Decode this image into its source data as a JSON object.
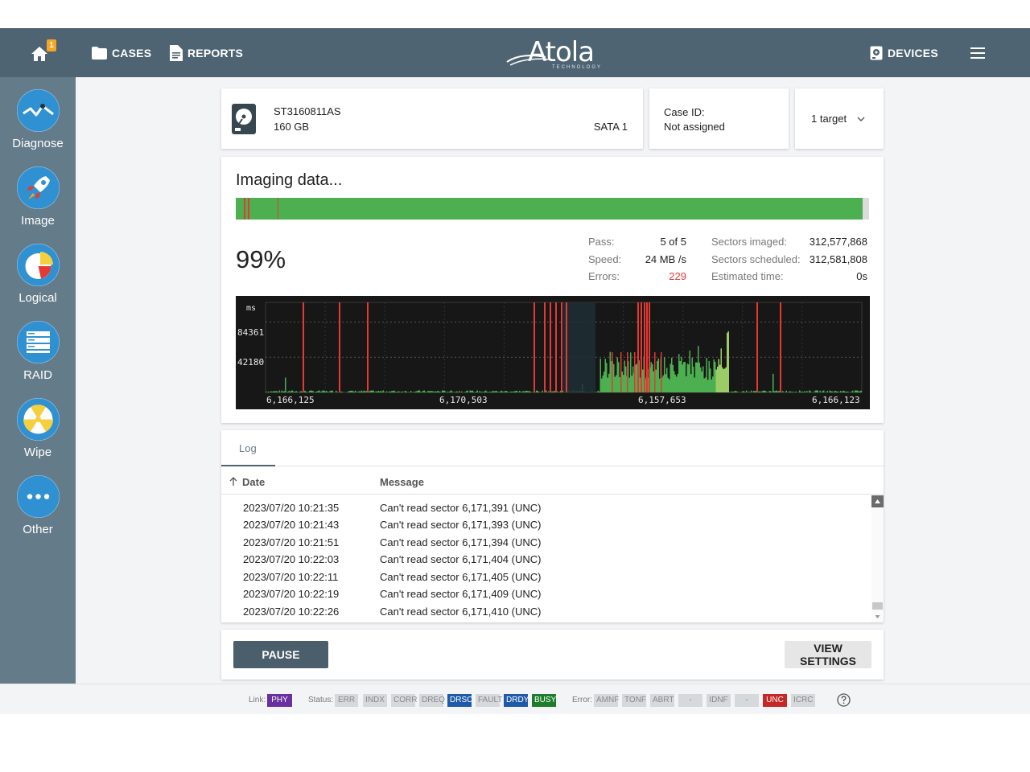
{
  "topbar": {
    "home_badge": "1",
    "cases_label": "CASES",
    "reports_label": "REPORTS",
    "logo_text": "Atola",
    "logo_subtext": "TECHNOLOGY",
    "devices_label": "DEVICES"
  },
  "sidebar": {
    "items": [
      {
        "label": "Diagnose",
        "icon": "diagnose-icon"
      },
      {
        "label": "Image",
        "icon": "rocket-icon"
      },
      {
        "label": "Logical",
        "icon": "pie-icon"
      },
      {
        "label": "RAID",
        "icon": "raid-icon"
      },
      {
        "label": "Wipe",
        "icon": "radiation-icon"
      },
      {
        "label": "Other",
        "icon": "dots-icon"
      }
    ]
  },
  "drive": {
    "model": "ST3160811AS",
    "capacity": "160 GB",
    "port": "SATA 1"
  },
  "case": {
    "label": "Case ID:",
    "value": "Not assigned"
  },
  "target": {
    "label": "1 target"
  },
  "imaging": {
    "title": "Imaging data...",
    "percent": "99%",
    "progress_fraction": 0.99,
    "pass_label": "Pass:",
    "pass_value": "5 of 5",
    "speed_label": "Speed:",
    "speed_value": "24 MB /s",
    "errors_label": "Errors:",
    "errors_value": "229",
    "sectors_imaged_label": "Sectors imaged:",
    "sectors_imaged_value": "312,577,868",
    "sectors_scheduled_label": "Sectors scheduled:",
    "sectors_scheduled_value": "312,581,808",
    "estimated_label": "Estimated time:",
    "estimated_value": "0s"
  },
  "chart_data": {
    "type": "bar",
    "unit_label": "ms",
    "y_ticks": [
      "84361",
      "42180"
    ],
    "y_tick_values": [
      84361,
      42180
    ],
    "x_tick_labels": [
      "6,166,125",
      "6,170,503",
      "6,157,653",
      "6,166,123"
    ],
    "grid": true,
    "colors": {
      "normal": "#4caf50",
      "error": "#e53935",
      "background": "#171717"
    }
  },
  "log": {
    "tab_label": "Log",
    "col_date": "Date",
    "col_message": "Message",
    "rows": [
      {
        "date": "2023/07/20 10:21:35",
        "message": "Can't read sector 6,171,391 (UNC)"
      },
      {
        "date": "2023/07/20 10:21:43",
        "message": "Can't read sector 6,171,393 (UNC)"
      },
      {
        "date": "2023/07/20 10:21:51",
        "message": "Can't read sector 6,171,394 (UNC)"
      },
      {
        "date": "2023/07/20 10:22:03",
        "message": "Can't read sector 6,171,404 (UNC)"
      },
      {
        "date": "2023/07/20 10:22:11",
        "message": "Can't read sector 6,171,405 (UNC)"
      },
      {
        "date": "2023/07/20 10:22:19",
        "message": "Can't read sector 6,171,409 (UNC)"
      },
      {
        "date": "2023/07/20 10:22:26",
        "message": "Can't read sector 6,171,410 (UNC)"
      }
    ]
  },
  "actions": {
    "pause_label": "PAUSE",
    "settings_label": "VIEW SETTINGS"
  },
  "statusbar": {
    "link_label": "Link:",
    "link_chip": "PHY",
    "status_label": "Status:",
    "status_chips": [
      "ERR",
      "INDX",
      "CORR",
      "DREQ",
      "DRSC",
      "FAULT",
      "DRDY",
      "BUSY"
    ],
    "error_label": "Error:",
    "error_chips": [
      "AMNF",
      "TONF",
      "ABRT",
      "-",
      "IDNF",
      "-",
      "UNC",
      "ICRC"
    ],
    "help_icon": "help-icon"
  }
}
